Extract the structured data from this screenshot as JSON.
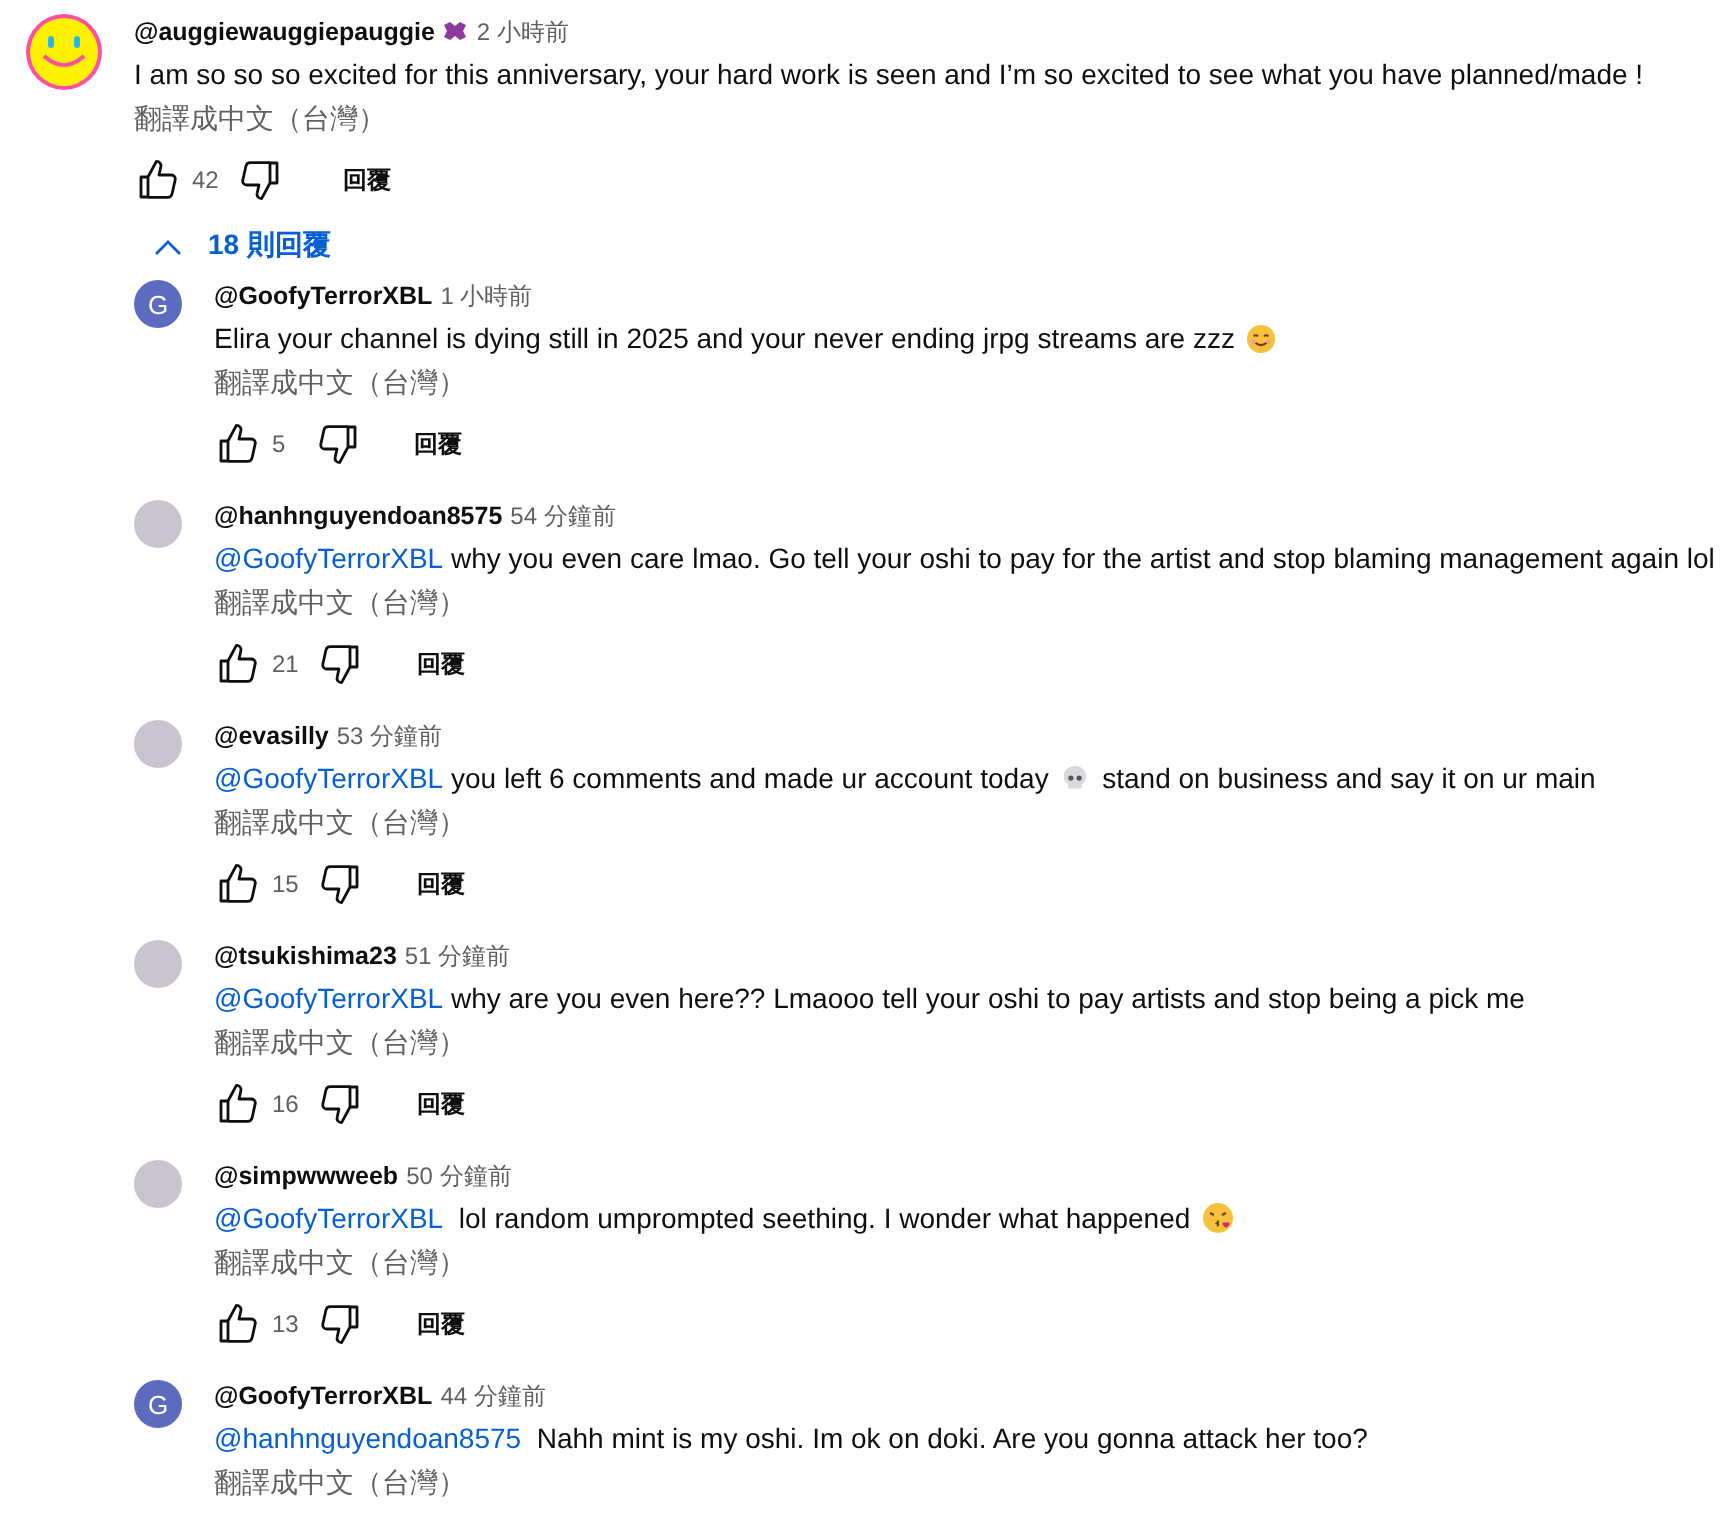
{
  "top_comment": {
    "avatar": {
      "kind": "smiley"
    },
    "author": "@auggiewauggiepauggie",
    "member_badge": true,
    "time": "2 小時前",
    "body": [
      {
        "kind": "text",
        "text": "I am so so so excited for this anniversary, your hard work is seen and I’m so excited to see what you have planned/made !"
      }
    ],
    "translate": "翻譯成中文（台灣）",
    "likes": "42",
    "reply": "回覆"
  },
  "replies_toggle": {
    "label": "18 則回覆",
    "expanded": true
  },
  "replies": [
    {
      "avatar": {
        "kind": "letter",
        "letter": "G"
      },
      "author": "@GoofyTerrorXBL",
      "time": "1 小時前",
      "body": [
        {
          "kind": "text",
          "text": "Elira your channel is dying still in 2025 and your never ending jrpg streams are zzz "
        },
        {
          "kind": "smile"
        }
      ],
      "translate": "翻譯成中文（台灣）",
      "likes": "5",
      "reply": "回覆"
    },
    {
      "avatar": {
        "kind": "photo"
      },
      "author": "@hanhnguyendoan8575",
      "time": "54 分鐘前",
      "body": [
        {
          "kind": "mention",
          "text": "@GoofyTerrorXBL"
        },
        {
          "kind": "text",
          "text": " why you even care lmao. Go tell your oshi to pay for the artist and stop blaming management again lol"
        }
      ],
      "translate": "翻譯成中文（台灣）",
      "likes": "21",
      "reply": "回覆"
    },
    {
      "avatar": {
        "kind": "photo"
      },
      "author": "@evasilly",
      "time": "53 分鐘前",
      "body": [
        {
          "kind": "mention",
          "text": "@GoofyTerrorXBL"
        },
        {
          "kind": "text",
          "text": " you left 6 comments and made ur account today "
        },
        {
          "kind": "skull"
        },
        {
          "kind": "text",
          "text": " stand on business and say it on ur main"
        }
      ],
      "translate": "翻譯成中文（台灣）",
      "likes": "15",
      "reply": "回覆"
    },
    {
      "avatar": {
        "kind": "photo"
      },
      "author": "@tsukishima23",
      "time": "51 分鐘前",
      "body": [
        {
          "kind": "mention",
          "text": "@GoofyTerrorXBL"
        },
        {
          "kind": "text",
          "text": " why are you even here?? Lmaooo tell your oshi to pay artists and stop being a pick me"
        }
      ],
      "translate": "翻譯成中文（台灣）",
      "likes": "16",
      "reply": "回覆"
    },
    {
      "avatar": {
        "kind": "photo"
      },
      "author": "@simpwwweeb",
      "time": "50 分鐘前",
      "body": [
        {
          "kind": "mention",
          "text": "@GoofyTerrorXBL"
        },
        {
          "kind": "text",
          "text": "  lol random umprompted seething. I wonder what happened "
        },
        {
          "kind": "kiss"
        }
      ],
      "translate": "翻譯成中文（台灣）",
      "likes": "13",
      "reply": "回覆"
    },
    {
      "avatar": {
        "kind": "letter",
        "letter": "G"
      },
      "author": "@GoofyTerrorXBL",
      "time": "44 分鐘前",
      "body": [
        {
          "kind": "mention",
          "text": "@hanhnguyendoan8575"
        },
        {
          "kind": "text",
          "text": "  Nahh mint is my oshi. Im ok on doki. Are you gonna attack her too?"
        }
      ],
      "translate": "翻譯成中文（台灣）"
    }
  ]
}
